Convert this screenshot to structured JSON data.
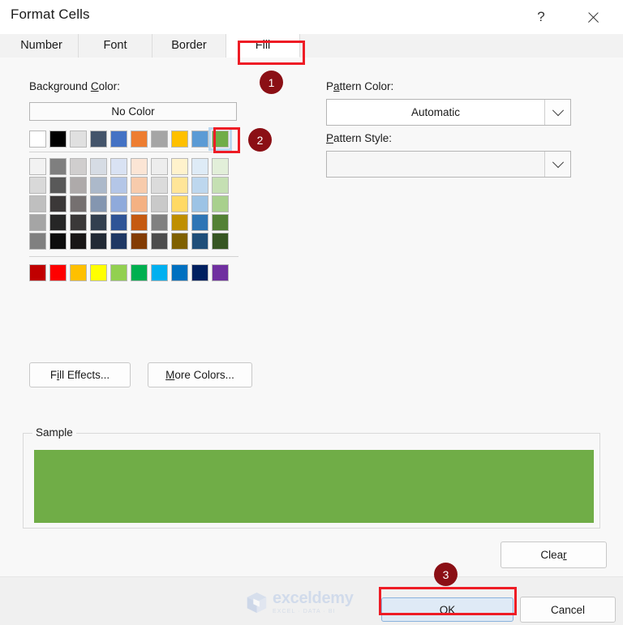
{
  "window": {
    "title": "Format Cells",
    "help_label": "?",
    "help_icon": "question-mark-icon",
    "close_icon": "close-icon"
  },
  "tabs": [
    {
      "label": "Number",
      "active": false
    },
    {
      "label": "Font",
      "active": false
    },
    {
      "label": "Border",
      "active": false
    },
    {
      "label": "Fill",
      "active": true
    }
  ],
  "fill_tab": {
    "background_color": {
      "label_pre": "Background ",
      "label_accel": "C",
      "label_post": "olor:",
      "no_color_label": "No Color",
      "theme_colors": [
        "#FFFFFF",
        "#000000",
        "#E0E0E0",
        "#44546A",
        "#4472C4",
        "#ED7D31",
        "#A5A5A5",
        "#FFC000",
        "#5B9BD5",
        "#70AD47"
      ],
      "selected_index": 9,
      "selected_color": "#70AD47",
      "tint_rows": [
        [
          "#F2F2F2",
          "#7F7F7F",
          "#D0CECE",
          "#D6DCE4",
          "#D9E2F3",
          "#FBE5D5",
          "#EDEDED",
          "#FFF2CC",
          "#DEEBF6",
          "#E2EFD9"
        ],
        [
          "#D9D9D9",
          "#595959",
          "#AEAAAA",
          "#ACB9CA",
          "#B4C6E7",
          "#F7CBAC",
          "#DBDBDB",
          "#FFE598",
          "#BDD7EE",
          "#C5E0B3"
        ],
        [
          "#BFBFBF",
          "#3B3838",
          "#757070",
          "#8496B0",
          "#8FAADB",
          "#F4B183",
          "#C9C9C9",
          "#FFD965",
          "#9CC3E5",
          "#A8D08D"
        ],
        [
          "#A5A5A5",
          "#262626",
          "#3A3838",
          "#323F4F",
          "#2F5496",
          "#C55A11",
          "#808080",
          "#BF8F00",
          "#2E75B5",
          "#538135"
        ],
        [
          "#808080",
          "#0C0C0C",
          "#181616",
          "#222A35",
          "#1F3864",
          "#833C04",
          "#4D4D4D",
          "#7F6000",
          "#1F4E79",
          "#375623"
        ]
      ],
      "standard_colors": [
        "#C00000",
        "#FF0000",
        "#FFC000",
        "#FFFF00",
        "#92D050",
        "#00B050",
        "#00B0F0",
        "#0070C0",
        "#002060",
        "#7030A0"
      ]
    },
    "fill_effects_button": {
      "pre": "F",
      "accel": "i",
      "post": "ll Effects..."
    },
    "more_colors_button": {
      "pre": "",
      "accel": "M",
      "post": "ore Colors..."
    },
    "pattern_color": {
      "label_pre": "P",
      "label_accel": "a",
      "label_post": "ttern Color:",
      "value": "Automatic",
      "arrow_icon": "chevron-down-icon"
    },
    "pattern_style": {
      "label_pre": "",
      "label_accel": "P",
      "label_post": "attern Style:",
      "value": "",
      "arrow_icon": "chevron-down-icon"
    },
    "sample": {
      "legend": "Sample",
      "fill_color": "#70AD47"
    }
  },
  "footer": {
    "clear_button": {
      "pre": "Clea",
      "accel": "r",
      "post": ""
    },
    "ok_button": "OK",
    "cancel_button": "Cancel"
  },
  "watermark": {
    "name": "exceldemy",
    "subtitle": "EXCEL · DATA · BI",
    "logo_icon": "cube-logo-icon"
  },
  "annotations": {
    "badges": [
      {
        "number": "1",
        "target": "fill-tab"
      },
      {
        "number": "2",
        "target": "selected-green-swatch"
      },
      {
        "number": "3",
        "target": "ok-button"
      }
    ],
    "highlight_color": "#EE1C25",
    "badge_color": "#8B0F15"
  }
}
